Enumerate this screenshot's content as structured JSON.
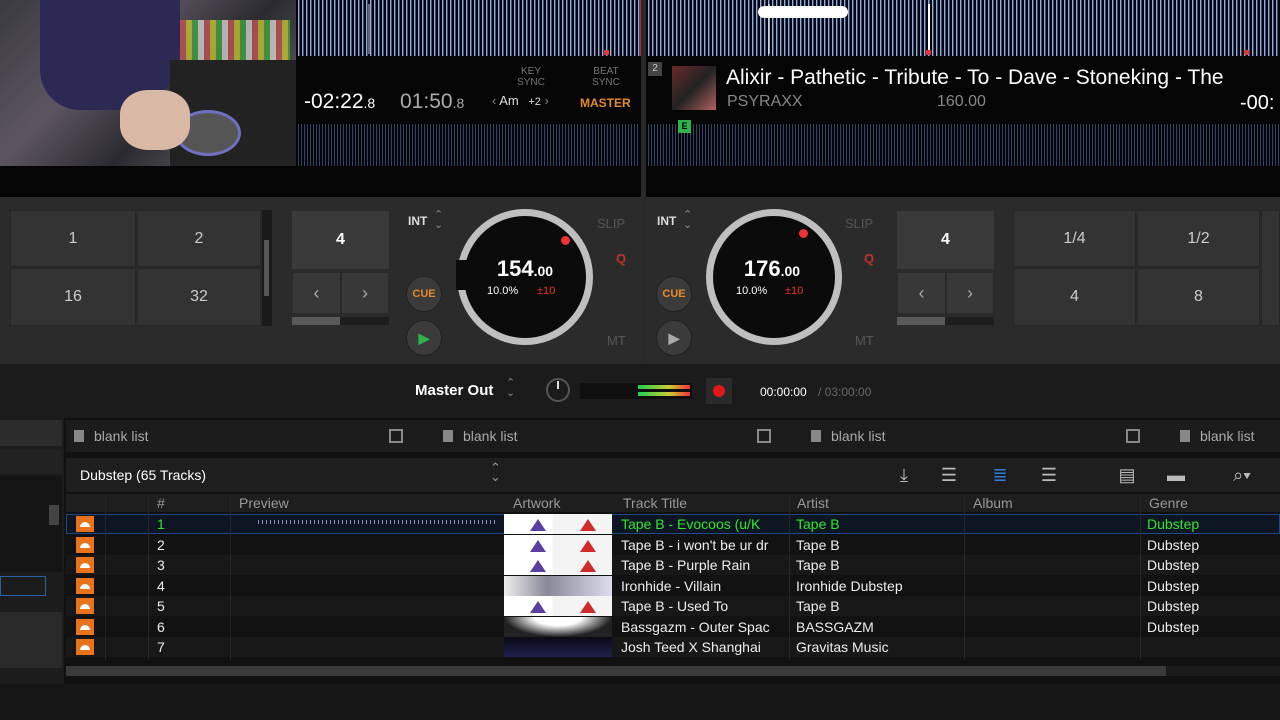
{
  "deck1": {
    "time_elapsed": "-02:22",
    "time_elapsed_frac": ".8",
    "time_remaining": "01:50",
    "time_remaining_frac": ".8",
    "key_sync_label": "KEY\nSYNC",
    "beat_sync_label": "BEAT\nSYNC",
    "key_value": "Am",
    "key_offset": "+2",
    "master_label": "MASTER",
    "loop_pads": [
      "1",
      "2",
      "16",
      "32"
    ],
    "loop_size": "4",
    "int_label": "INT",
    "slip_label": "SLIP",
    "q_label": "Q",
    "mt_label": "MT",
    "cue_label": "CUE",
    "bpm_int": "154",
    "bpm_dec": ".00",
    "pitch_pct": "10.0%",
    "pitch_range": "±10"
  },
  "deck2": {
    "number": "2",
    "title": "Alixir - Pathetic - Tribute - To - Dave - Stoneking - The",
    "artist": "PSYRAXX",
    "bpm_display": "160.00",
    "time_remaining": "-00:",
    "marker_label": "E",
    "loop_pads": [
      "1/4",
      "1/2",
      "4",
      "8"
    ],
    "loop_size": "4",
    "int_label": "INT",
    "slip_label": "SLIP",
    "q_label": "Q",
    "mt_label": "MT",
    "cue_label": "CUE",
    "bpm_int": "176",
    "bpm_dec": ".00",
    "pitch_pct": "10.0%",
    "pitch_range": "±10"
  },
  "master": {
    "label": "Master Out",
    "rec_time": "00:00:00",
    "rec_total": "/ 03:00:00"
  },
  "blank_lists": [
    "blank list",
    "blank list",
    "blank list",
    "blank list"
  ],
  "crate": {
    "name": "Dubstep (65 Tracks)"
  },
  "columns": [
    "#",
    "Preview",
    "Artwork",
    "Track Title",
    "Artist",
    "Album",
    "Genre"
  ],
  "tracks": [
    {
      "num": "1",
      "title": "Tape B - Evocoos (u/K",
      "artist": "Tape B",
      "album": "",
      "genre": "Dubstep"
    },
    {
      "num": "2",
      "title": "Tape B - i won't be ur dr",
      "artist": "Tape B",
      "album": "",
      "genre": "Dubstep"
    },
    {
      "num": "3",
      "title": "Tape B - Purple Rain",
      "artist": "Tape B",
      "album": "",
      "genre": "Dubstep"
    },
    {
      "num": "4",
      "title": "Ironhide - Villain",
      "artist": "Ironhide Dubstep",
      "album": "",
      "genre": "Dubstep"
    },
    {
      "num": "5",
      "title": "Tape B - Used To",
      "artist": "Tape B",
      "album": "",
      "genre": "Dubstep"
    },
    {
      "num": "6",
      "title": "Bassgazm - Outer Spac",
      "artist": "BASSGAZM",
      "album": "",
      "genre": "Dubstep"
    },
    {
      "num": "7",
      "title": "Josh Teed X Shanghai",
      "artist": "Gravitas Music",
      "album": "",
      "genre": ""
    }
  ],
  "colors": {
    "accent_orange": "#e58a2a",
    "cue_red": "#e33333",
    "selected_green": "#2ee82e",
    "rec_red": "#e01818"
  }
}
